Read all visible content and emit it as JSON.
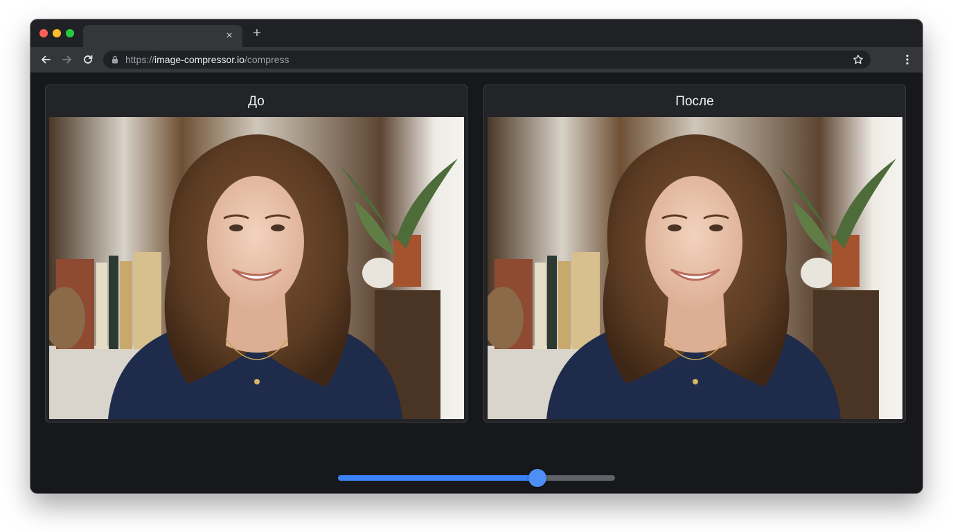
{
  "browser": {
    "tab": {
      "title": "",
      "close_glyph": "×"
    },
    "new_tab_glyph": "+",
    "address": {
      "scheme": "https://",
      "host": "image-compressor.io",
      "path": "/compress"
    },
    "icons": {
      "back": "arrow-left-icon",
      "forward": "arrow-right-icon",
      "reload": "reload-icon",
      "lock": "lock-icon",
      "bookmark": "star-icon",
      "menu": "kebab-menu-icon"
    }
  },
  "compare": {
    "before_label": "До",
    "after_label": "После"
  },
  "quality_slider": {
    "value_fraction": 0.72,
    "fill_color": "#3b82f6",
    "track_color": "#5f6368"
  },
  "colors": {
    "window_bg": "#17181b",
    "panel_bg": "#222428",
    "accent": "#4f8ef7"
  }
}
